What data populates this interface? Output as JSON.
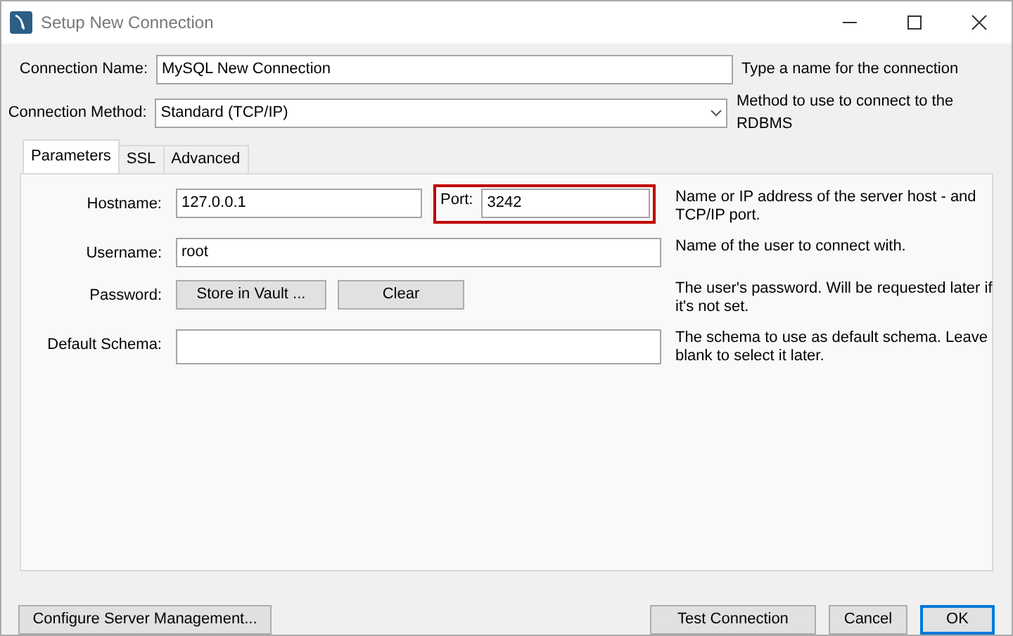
{
  "window": {
    "title": "Setup New Connection"
  },
  "connection_name": {
    "label": "Connection Name:",
    "value": "MySQL New Connection",
    "hint": "Type a name for the connection"
  },
  "connection_method": {
    "label": "Connection Method:",
    "value": "Standard (TCP/IP)",
    "hint": "Method to use to connect to the RDBMS"
  },
  "tabs": [
    {
      "label": "Parameters",
      "selected": true
    },
    {
      "label": "SSL",
      "selected": false
    },
    {
      "label": "Advanced",
      "selected": false
    }
  ],
  "parameters": [
    {
      "kind": "host",
      "label": "Hostname:",
      "value": "127.0.0.1",
      "port_label": "Port:",
      "port_value": "3242",
      "port_highlighted": true,
      "hint": "Name or IP address of the server host - and TCP/IP port."
    },
    {
      "kind": "text",
      "label": "Username:",
      "value": "root",
      "hint": "Name of the user to connect with."
    },
    {
      "kind": "buttons",
      "label": "Password:",
      "buttons": [
        "Store in Vault ...",
        "Clear"
      ],
      "hint": "The user's password. Will be requested later if it's not set."
    },
    {
      "kind": "text",
      "label": "Default Schema:",
      "hint": "The schema to use as default schema. Leave blank to select it later."
    }
  ],
  "left_buttons": [
    {
      "label": "Configure Server Management...",
      "default": false
    }
  ],
  "right_buttons": [
    {
      "label": "Test Connection",
      "default": false
    },
    {
      "label": "Cancel",
      "default": false
    },
    {
      "label": "OK",
      "default": true
    }
  ]
}
